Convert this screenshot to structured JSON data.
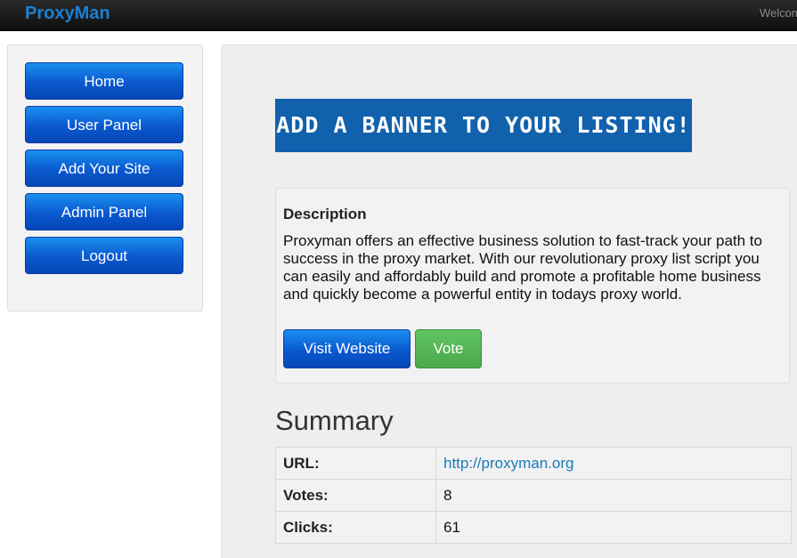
{
  "header": {
    "brand": "ProxyMan",
    "welcome_text": "Welcome"
  },
  "sidebar": {
    "items": [
      {
        "label": "Home"
      },
      {
        "label": "User Panel"
      },
      {
        "label": "Add Your Site"
      },
      {
        "label": "Admin Panel"
      },
      {
        "label": "Logout"
      }
    ]
  },
  "main": {
    "banner_text": "ADD A BANNER TO YOUR LISTING!",
    "description": {
      "title": "Description",
      "text": "Proxyman offers an effective business solution to fast-track your path to success in the proxy market. With our revolutionary proxy list script you can easily and affordably build and promote a profitable home business and quickly become a powerful entity in todays proxy world.",
      "visit_label": "Visit Website",
      "vote_label": "Vote"
    },
    "summary": {
      "title": "Summary",
      "rows": [
        {
          "key": "URL:",
          "value": "http://proxyman.org"
        },
        {
          "key": "Votes:",
          "value": "8"
        },
        {
          "key": "Clicks:",
          "value": "61"
        }
      ]
    }
  },
  "colors": {
    "brand": "#1b7fd3",
    "nav_button": "#0a58cf",
    "vote_button": "#4aa84a",
    "banner": "#1261ad",
    "link": "#1a7ab8"
  }
}
